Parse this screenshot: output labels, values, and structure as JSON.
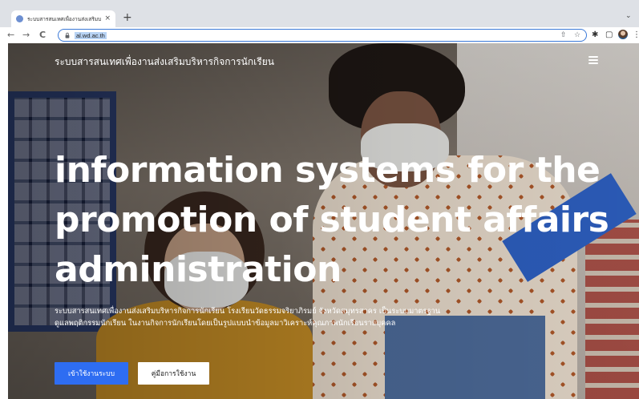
{
  "browser": {
    "tab_title": "ระบบสารสนเทศเพื่องานส่งเสริมบริหาร",
    "tab_close": "×",
    "new_tab": "+",
    "tab_menu": "⌄",
    "back": "←",
    "forward": "→",
    "reload": "C",
    "url": "al.wd.ac.th",
    "share_icon": "⇧",
    "bookmark_star": "☆",
    "extensions_icon": "✱",
    "sidepanel_icon": "▢",
    "menu_icon": "⋮"
  },
  "site": {
    "title": "ระบบสารสนเทศเพื่องานส่งเสริมบริหารกิจการนักเรียน"
  },
  "hero": {
    "headline": "information systems for the promotion of student affairs administration",
    "description": "ระบบสารสนเทศเพื่องานส่งเสริมบริหารกิจการนักเรียน โรงเรียนวัดธรรมจริยาภิรมย์ จังหวัดสมุทรสาคร เป็นระบบมาตรฐานดูแลพฤติกรรมนักเรียน ในงานกิจการนักเรียนโดยเป็นรูปแบบนำข้อมูลมาวิเคราะห์คุณภาพนักเรียนรายบุคคล",
    "login_button": "เข้าใช้งานระบบ",
    "manual_button": "คู่มือการใช้งาน"
  },
  "colors": {
    "primary_button": "#2e6df2",
    "omnibox_focus": "#3a79d8"
  }
}
